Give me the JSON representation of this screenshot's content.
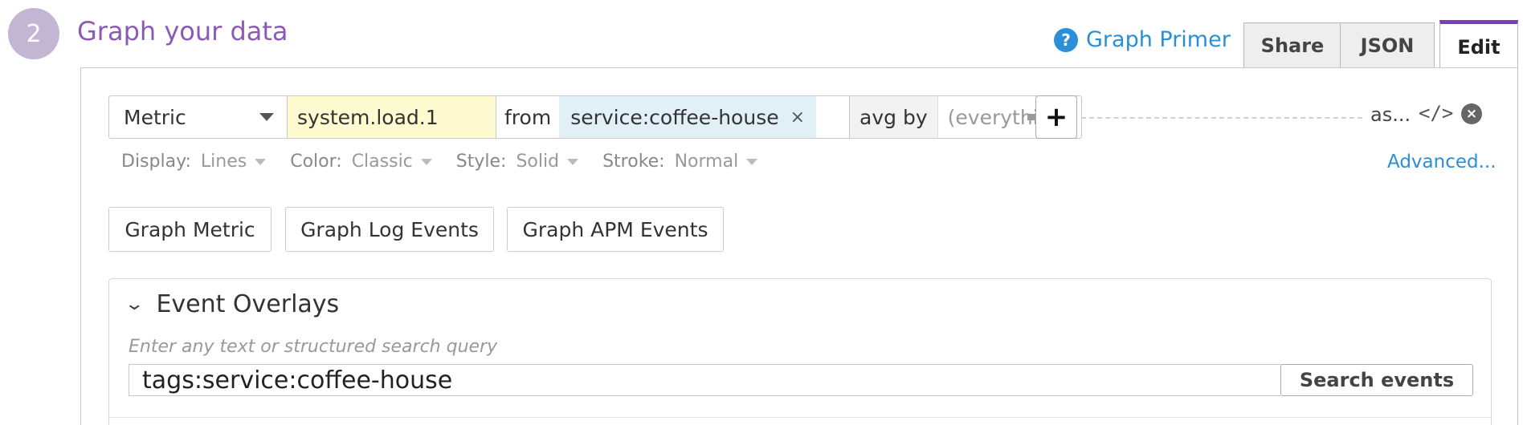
{
  "step": {
    "number": "2",
    "title": "Graph your data"
  },
  "header": {
    "primer_icon": "question-icon",
    "primer_label": "Graph Primer",
    "tabs": [
      {
        "label": "Share",
        "active": false
      },
      {
        "label": "JSON",
        "active": false
      },
      {
        "label": "Edit",
        "active": true
      }
    ]
  },
  "query": {
    "source_type": "Metric",
    "metric_name": "system.load.1",
    "from_label": "from",
    "tag": "service:coffee-house",
    "tag_remove": "×",
    "avg_by_label": "avg by",
    "avg_by_placeholder": "(everything)",
    "add_label": "+",
    "alias_label": "as...",
    "code_label": "</>",
    "remove_label": "×"
  },
  "options": [
    {
      "label": "Display:",
      "value": "Lines"
    },
    {
      "label": "Color:",
      "value": "Classic"
    },
    {
      "label": "Style:",
      "value": "Solid"
    },
    {
      "label": "Stroke:",
      "value": "Normal"
    }
  ],
  "advanced_label": "Advanced...",
  "graph_buttons": {
    "metric": "Graph Metric",
    "log": "Graph Log Events",
    "apm": "Graph APM Events"
  },
  "event_overlays": {
    "title": "Event Overlays",
    "hint": "Enter any text or structured search query",
    "query_value": "tags:service:coffee-house",
    "search_button": "Search events"
  },
  "colors": {
    "accent": "#7b3fb5",
    "title": "#8b5ab4",
    "link": "#2a8fd6",
    "metric_bg": "#fffbd0",
    "tag_bg": "#e1f0f7"
  }
}
